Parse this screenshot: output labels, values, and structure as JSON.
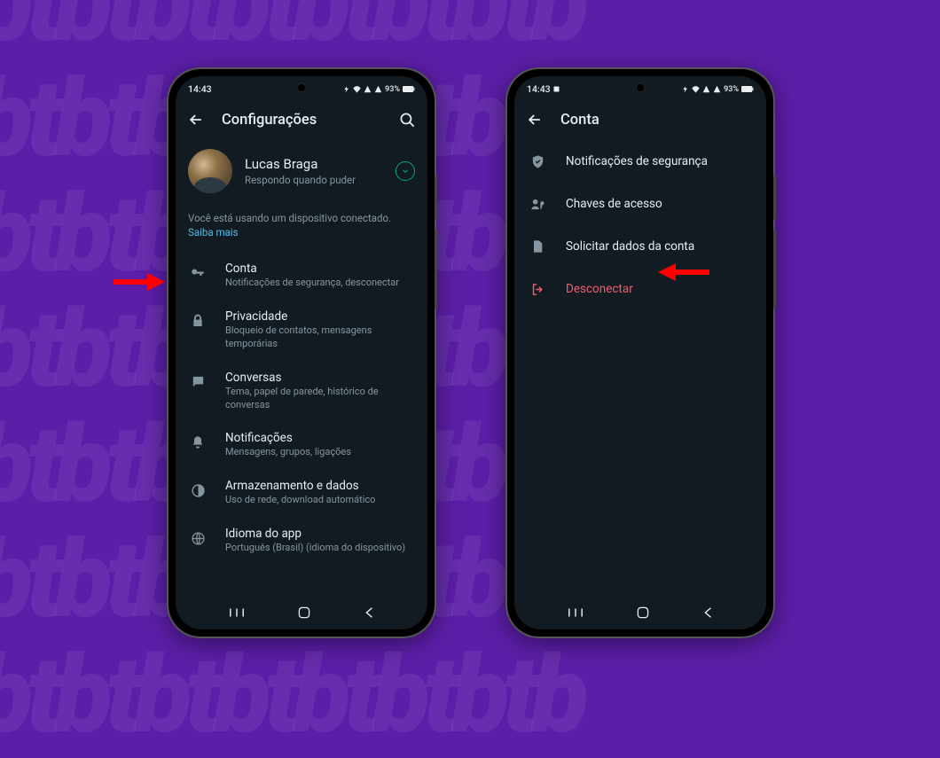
{
  "status": {
    "time": "14:43",
    "battery": "93%"
  },
  "phone1": {
    "header": {
      "title": "Configurações"
    },
    "profile": {
      "name": "Lucas Braga",
      "status": "Respondo quando puder"
    },
    "notice": {
      "text": "Você está usando um dispositivo conectado. ",
      "link": "Saiba mais"
    },
    "settings": [
      {
        "icon": "key",
        "title": "Conta",
        "sub": "Notificações de segurança, desconectar"
      },
      {
        "icon": "lock",
        "title": "Privacidade",
        "sub": "Bloqueio de contatos, mensagens temporárias"
      },
      {
        "icon": "chat",
        "title": "Conversas",
        "sub": "Tema, papel de parede, histórico de conversas"
      },
      {
        "icon": "bell",
        "title": "Notificações",
        "sub": "Mensagens, grupos, ligações"
      },
      {
        "icon": "data",
        "title": "Armazenamento e dados",
        "sub": "Uso de rede, download automático"
      },
      {
        "icon": "globe",
        "title": "Idioma do app",
        "sub": "Português (Brasil) (idioma do dispositivo)"
      }
    ]
  },
  "phone2": {
    "header": {
      "title": "Conta"
    },
    "items": [
      {
        "icon": "shield",
        "label": "Notificações de segurança",
        "danger": false
      },
      {
        "icon": "passkey",
        "label": "Chaves de acesso",
        "danger": false
      },
      {
        "icon": "doc",
        "label": "Solicitar dados da conta",
        "danger": false
      },
      {
        "icon": "logout",
        "label": "Desconectar",
        "danger": true
      }
    ]
  }
}
